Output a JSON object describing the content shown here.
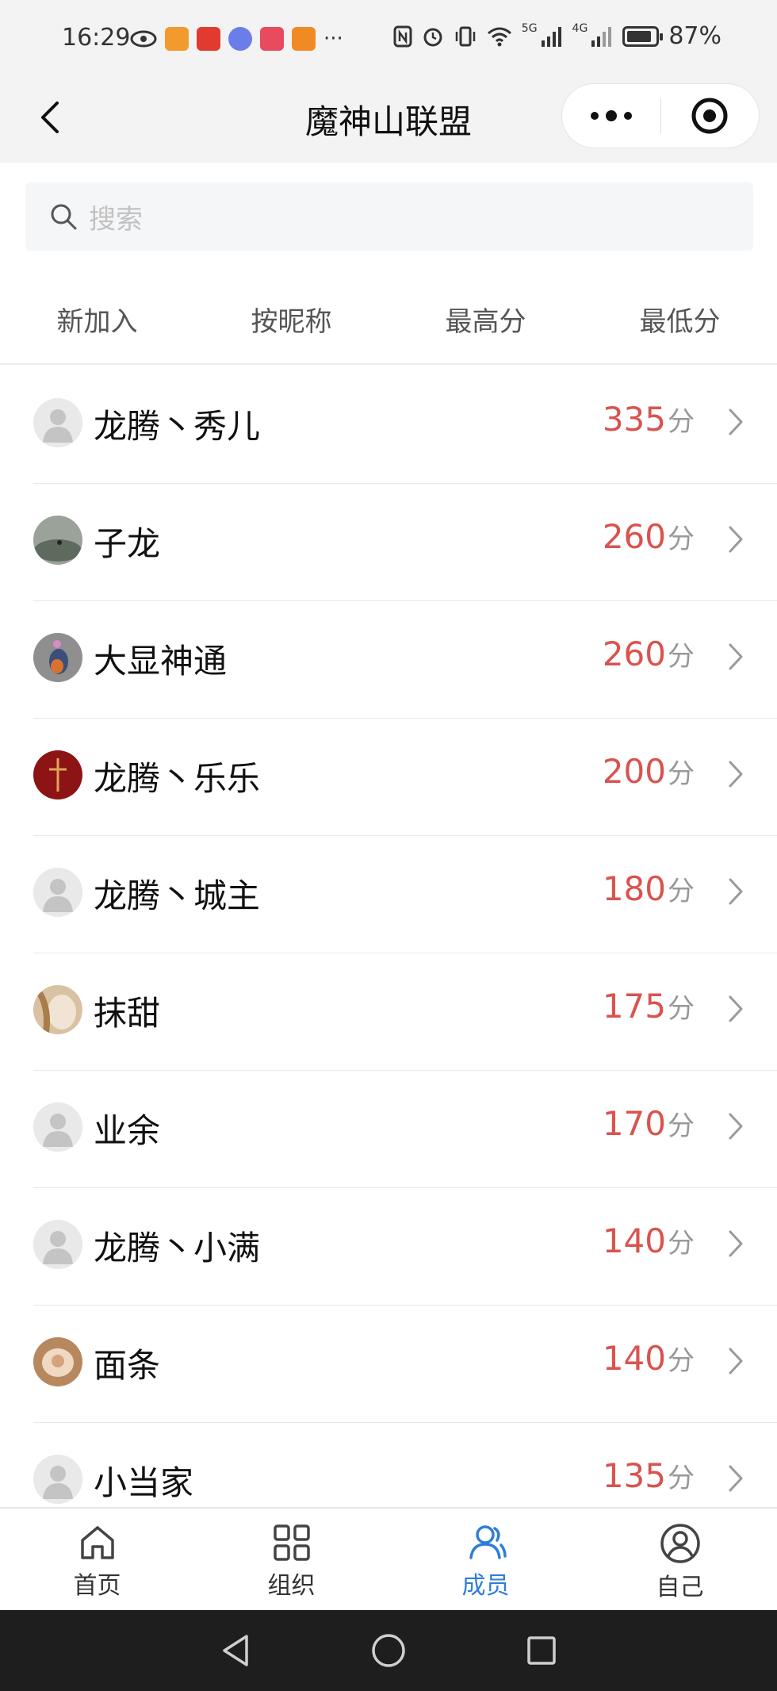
{
  "status_bar": {
    "time": "16:29",
    "dots": "···",
    "net_5g": "5G",
    "net_4g": "4G",
    "battery_level": 0.87,
    "battery_text": "87%"
  },
  "header": {
    "title": "魔神山联盟"
  },
  "search": {
    "placeholder": "搜索"
  },
  "tabs": [
    {
      "label": "新加入",
      "active": false
    },
    {
      "label": "按昵称",
      "active": false
    },
    {
      "label": "最高分",
      "active": true
    },
    {
      "label": "最低分",
      "active": false
    }
  ],
  "members": [
    {
      "name": "龙腾丶秀儿",
      "score": "335",
      "unit": "分",
      "avatar": "default"
    },
    {
      "name": "子龙",
      "score": "260",
      "unit": "分",
      "avatar": "photo-gray"
    },
    {
      "name": "大显神通",
      "score": "260",
      "unit": "分",
      "avatar": "photo-bird"
    },
    {
      "name": "龙腾丶乐乐",
      "score": "200",
      "unit": "分",
      "avatar": "photo-red"
    },
    {
      "name": "龙腾丶城主",
      "score": "180",
      "unit": "分",
      "avatar": "default"
    },
    {
      "name": "抹甜",
      "score": "175",
      "unit": "分",
      "avatar": "photo-warm"
    },
    {
      "name": "业余",
      "score": "170",
      "unit": "分",
      "avatar": "default"
    },
    {
      "name": "龙腾丶小满",
      "score": "140",
      "unit": "分",
      "avatar": "default"
    },
    {
      "name": "面条",
      "score": "140",
      "unit": "分",
      "avatar": "photo-food"
    },
    {
      "name": "小当家",
      "score": "135",
      "unit": "分",
      "avatar": "default"
    }
  ],
  "bottom_nav": [
    {
      "label": "首页",
      "icon": "home-icon",
      "active": false
    },
    {
      "label": "组织",
      "icon": "grid-icon",
      "active": false
    },
    {
      "label": "成员",
      "icon": "members-icon",
      "active": true
    },
    {
      "label": "自己",
      "icon": "profile-icon",
      "active": false
    }
  ],
  "colors": {
    "accent_red": "#d6232f",
    "score_red": "#d9534f",
    "nav_active_blue": "#2f7ed8"
  }
}
